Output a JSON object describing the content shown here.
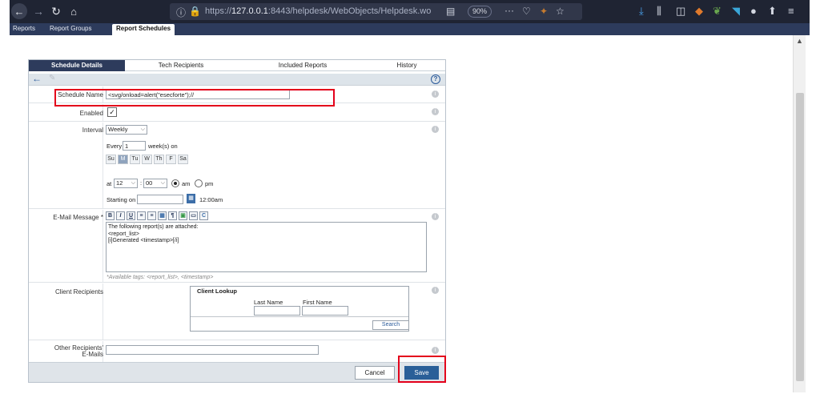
{
  "browser": {
    "url_prefix": "https://",
    "url_host": "127.0.0.1",
    "url_rest": ":8443/helpdesk/WebObjects/Helpdesk.wo",
    "zoom": "90%"
  },
  "app_tabs": {
    "reports": "Reports",
    "report_groups": "Report Groups",
    "report_schedules": "Report Schedules"
  },
  "panel_tabs": [
    "Schedule Details",
    "Tech Recipients",
    "Included Reports",
    "History"
  ],
  "form": {
    "schedule_name_label": "Schedule Name",
    "schedule_name_value": "<svg/onload=alert(\"esecforte\");//",
    "enabled_label": "Enabled",
    "interval_label": "Interval",
    "interval_value": "Weekly",
    "every_label": "Every",
    "every_value": "1",
    "weeks_on_label": "week(s) on",
    "days": [
      "Su",
      "M",
      "Tu",
      "W",
      "Th",
      "F",
      "Sa"
    ],
    "at_label": "at",
    "hour_value": "12",
    "minute_value": "00",
    "am_label": "am",
    "pm_label": "pm",
    "starting_on_label": "Starting on",
    "start_time": "12:00am",
    "email_label": "E-Mail Message",
    "required_mark": "*",
    "rte_buttons": [
      "B",
      "I",
      "U",
      "≡",
      "≡",
      "▦",
      "¶",
      "▣",
      "▭",
      "C"
    ],
    "email_body": "The following report(s) are attached:\n<report_list>\n[i]Generated <timestamp>[/i]",
    "tags_hint": "*Available tags: <report_list>, <timestamp>",
    "client_recipients_label": "Client Recipients",
    "client_lookup_title": "Client Lookup",
    "last_name_label": "Last Name",
    "first_name_label": "First Name",
    "search_label": "Search",
    "other_recipients_label_1": "Other Recipients'",
    "other_recipients_label_2": "E-Mails"
  },
  "actions": {
    "cancel": "Cancel",
    "save": "Save"
  },
  "colors": {
    "header_navy": "#2d3b5c",
    "save_blue": "#2a5f98",
    "highlight_red": "#e3001b"
  }
}
